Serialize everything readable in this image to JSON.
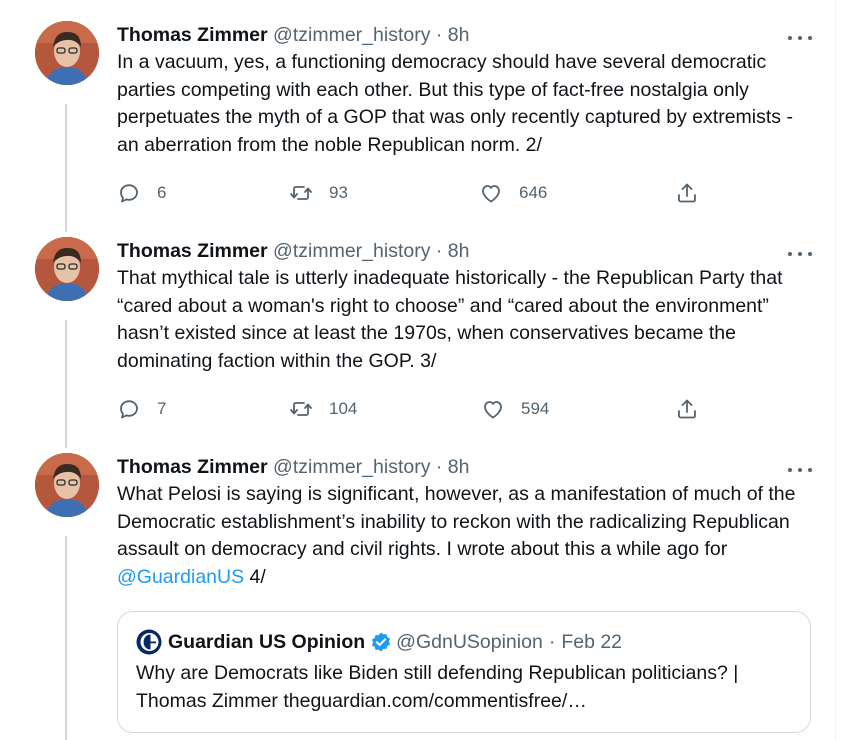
{
  "tweets": [
    {
      "author_name": "Thomas Zimmer",
      "handle": "@tzimmer_history",
      "separator": "·",
      "time": "8h",
      "text": "In a vacuum, yes, a functioning democracy should have several democratic parties competing with each other. But this type of fact-free nostalgia only perpetuates the myth of a GOP that was only recently captured by extremists - an aberration from the noble Republican norm. 2/",
      "replies": "6",
      "retweets": "93",
      "likes": "646"
    },
    {
      "author_name": "Thomas Zimmer",
      "handle": "@tzimmer_history",
      "separator": "·",
      "time": "8h",
      "text": "That mythical tale is utterly inadequate historically - the Republican Party that “cared about a woman's right to choose” and “cared about the environment” hasn’t existed since at least the 1970s, when conservatives became the dominating faction within the GOP. 3/",
      "replies": "7",
      "retweets": "104",
      "likes": "594"
    },
    {
      "author_name": "Thomas Zimmer",
      "handle": "@tzimmer_history",
      "separator": "·",
      "time": "8h",
      "text_before": "What Pelosi is saying is significant, however, as a manifestation of much of the Democratic establishment’s inability to reckon with the radicalizing Republican assault on democracy and civil rights. I wrote about this a while ago for ",
      "mention": "@GuardianUS",
      "text_after": " 4/",
      "quote": {
        "author_name": "Guardian US Opinion",
        "handle": "@GdnUSopinion",
        "separator": "·",
        "date": "Feb 22",
        "text": "Why are Democrats like Biden still defending Republican politicians? | Thomas Zimmer theguardian.com/commentisfree/…"
      }
    }
  ],
  "colors": {
    "text_primary": "#0f1419",
    "text_secondary": "#536471",
    "link": "#1d9bf0",
    "thread_line": "#cfd9de",
    "verified": "#1d9bf0"
  },
  "icons": [
    "avatar-photo",
    "more-icon",
    "reply-icon",
    "retweet-icon",
    "like-icon",
    "share-icon",
    "guardian-logo-icon",
    "verified-badge-icon"
  ]
}
